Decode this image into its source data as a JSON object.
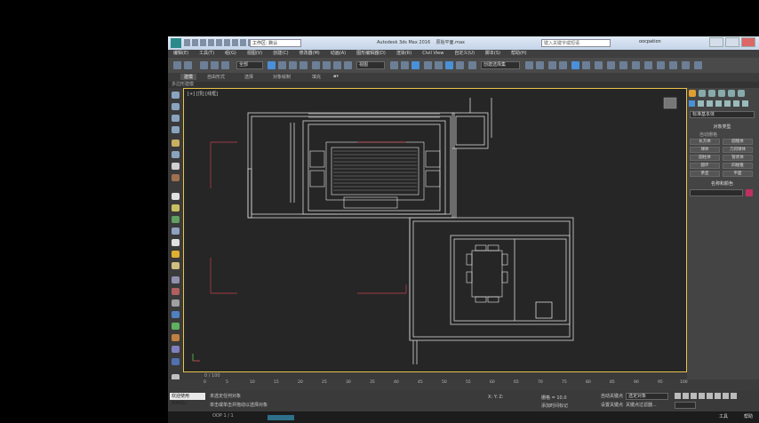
{
  "title_bar": {
    "workspace_label": "工作区: 默认",
    "app_title": "Autodesk 3ds Max 2016",
    "file_name": "原始平面.max",
    "search_placeholder": "键入关键字或短语",
    "user": "oocpation"
  },
  "menu": [
    "编辑(E)",
    "工具(T)",
    "组(G)",
    "视图(V)",
    "创建(C)",
    "修改器(M)",
    "动画(A)",
    "图形编辑器(D)",
    "渲染(R)",
    "Civil View",
    "自定义(U)",
    "脚本(S)",
    "帮助(H)"
  ],
  "toolbar": {
    "selection_filter": "全部",
    "reference_coord": "视图",
    "named_selection": "创建选择集"
  },
  "ribbon": {
    "tabs": [
      "建模",
      "自由形式",
      "选择",
      "对象绘制",
      "填充"
    ],
    "active_tab": "建模",
    "sub_label": "多边形建模"
  },
  "viewport": {
    "label": "[+] [顶] [线框]"
  },
  "command_panel": {
    "category": "标准基本体",
    "object_type_header": "对象类型",
    "autogrid": "自动栅格",
    "buttons": [
      "长方体",
      "圆锥体",
      "球体",
      "几何球体",
      "圆柱体",
      "管状体",
      "圆环",
      "四棱锥",
      "茶壶",
      "平面"
    ],
    "name_color_header": "名称和颜色"
  },
  "timeline": {
    "frame_counter": "0 / 100",
    "ticks": [
      "0",
      "5",
      "10",
      "15",
      "20",
      "25",
      "30",
      "35",
      "40",
      "45",
      "50",
      "55",
      "60",
      "65",
      "70",
      "75",
      "80",
      "85",
      "90",
      "95",
      "100"
    ]
  },
  "status": {
    "maxscript_label": "欢迎使用 MAXSc",
    "status_line1": "未选定任何对象",
    "status_line2": "单击或单击并拖动以选择对象",
    "coords": "X: Y: Z:",
    "grid": "栅格 = 10.0",
    "add_time_tag": "添加时间标记",
    "auto_key": "自动关键点",
    "auto_key_select": "选定对象",
    "set_key": "设置关键点",
    "key_filters": "关键点过滤器..."
  },
  "bottom": {
    "page_info": "OOP 1 / 1",
    "tool_label": "工具",
    "tool_label2": "帮助"
  },
  "colors": {
    "viewport_border": "#e8c44a",
    "viewport_bg": "#262626",
    "drawing_lines": "#d8d8d8",
    "red_guides": "#c04050",
    "color_swatch": "#c03060"
  }
}
